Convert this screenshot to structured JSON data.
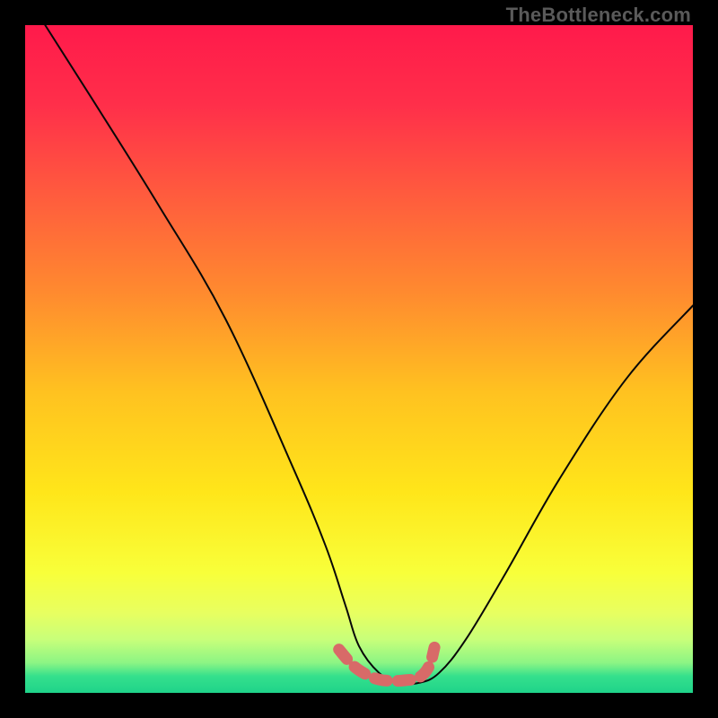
{
  "watermark": "TheBottleneck.com",
  "gradient_stops": [
    {
      "offset": 0.0,
      "color": "#ff1a4b"
    },
    {
      "offset": 0.12,
      "color": "#ff2f4a"
    },
    {
      "offset": 0.25,
      "color": "#ff5a3e"
    },
    {
      "offset": 0.4,
      "color": "#ff8a2f"
    },
    {
      "offset": 0.55,
      "color": "#ffc220"
    },
    {
      "offset": 0.7,
      "color": "#ffe61a"
    },
    {
      "offset": 0.82,
      "color": "#f8ff3a"
    },
    {
      "offset": 0.88,
      "color": "#e8ff60"
    },
    {
      "offset": 0.92,
      "color": "#c8ff7a"
    },
    {
      "offset": 0.955,
      "color": "#8cf584"
    },
    {
      "offset": 0.975,
      "color": "#35e08c"
    },
    {
      "offset": 1.0,
      "color": "#1fd38a"
    }
  ],
  "curve_color": "#080808",
  "curve_width": 2.0,
  "marker_color": "#d86a68",
  "chart_data": {
    "type": "line",
    "title": "",
    "xlabel": "",
    "ylabel": "",
    "xlim": [
      0,
      100
    ],
    "ylim": [
      0,
      100
    ],
    "series": [
      {
        "name": "curve",
        "x": [
          3,
          10,
          20,
          30,
          40,
          45,
          48,
          50,
          53,
          56,
          59,
          62,
          66,
          72,
          80,
          90,
          100
        ],
        "y": [
          100,
          89,
          73,
          56,
          34,
          22,
          13,
          7,
          3,
          1.5,
          1.5,
          3,
          8,
          18,
          32,
          47,
          58
        ]
      },
      {
        "name": "bottom-marker",
        "x": [
          47,
          49,
          51,
          53,
          55,
          57,
          59,
          60.5,
          61.3
        ],
        "y": [
          6.5,
          4.2,
          2.8,
          2.0,
          1.8,
          1.9,
          2.3,
          4.0,
          6.8
        ]
      }
    ]
  }
}
